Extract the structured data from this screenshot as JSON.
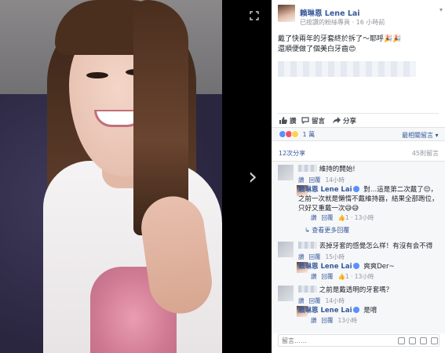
{
  "post": {
    "author": "賴琳恩 Lene Lai",
    "subtitle": "已按讚的粉絲專頁 · 16 小時前",
    "message_line1": "戴了快兩年的牙套終於拆了～耶呼🎉🎉",
    "message_line2": "還順便做了個美白牙齒😍"
  },
  "actions": {
    "like": "讚",
    "comment": "留言",
    "share": "分享"
  },
  "reactions": {
    "count": "1 萬",
    "relevance": "最相關留言"
  },
  "stats": {
    "shares": "12次分享",
    "comments_count": "45則留言"
  },
  "comments": [
    {
      "name": "",
      "text": "維持的開始!",
      "like": "讚",
      "reply": "回覆",
      "time": "14小時"
    },
    {
      "name": "賴琳恩 Lene Lai",
      "text": "對…這是第二次戴了😌，之前一次就是懶惰不戴維持器，結果全部跑位，只好又重戴一次😅😅",
      "like": "讚",
      "reply": "回覆",
      "likes": "1",
      "time": "13小時"
    },
    {
      "more": "查看更多回覆"
    },
    {
      "name": "",
      "text": "丟掉牙套的感覺怎么样！有沒有会不得",
      "like": "讚",
      "reply": "回覆",
      "time": "15小時"
    },
    {
      "name": "賴琳恩 Lene Lai",
      "text": "爽爽Der~",
      "like": "讚",
      "reply": "回覆",
      "likes": "1",
      "time": "13小時"
    },
    {
      "name": "",
      "text": "之前是戴透明的牙套嗎？",
      "like": "讚",
      "reply": "回覆",
      "time": "14小時"
    },
    {
      "name": "賴琳恩 Lene Lai",
      "text": "是唷",
      "like": "讚",
      "reply": "回覆",
      "time": "13小時"
    }
  ],
  "composer": {
    "placeholder": "留言……"
  },
  "viewer": {
    "watermark": ""
  }
}
